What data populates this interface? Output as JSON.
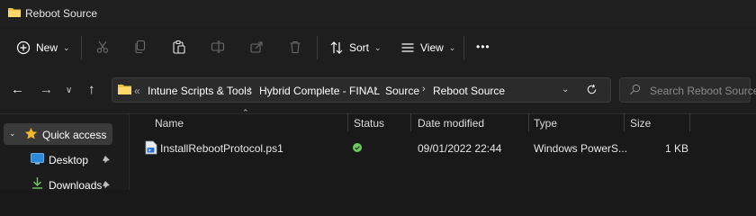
{
  "window": {
    "title": "Reboot Source"
  },
  "toolbar": {
    "new_label": "New",
    "sort_label": "Sort",
    "view_label": "View",
    "more_label": "•••"
  },
  "nav": {
    "back": "←",
    "forward": "→",
    "down": "∨",
    "up": "↑"
  },
  "address": {
    "overflow": "«",
    "crumbs": [
      "Intune Scripts & Tools",
      "Hybrid Complete - FINAL",
      "Source",
      "Reboot Source"
    ],
    "separator": "›"
  },
  "search": {
    "placeholder": "Search Reboot Source"
  },
  "sidebar": {
    "items": [
      {
        "label": "Quick access",
        "icon": "star-icon"
      },
      {
        "label": "Desktop",
        "icon": "desktop-icon",
        "pinned": true
      },
      {
        "label": "Downloads",
        "icon": "download-icon",
        "pinned": true
      }
    ]
  },
  "columns": {
    "name": "Name",
    "status": "Status",
    "date": "Date modified",
    "type": "Type",
    "size": "Size"
  },
  "files": [
    {
      "name": "InstallRebootProtocol.ps1",
      "status": "synced",
      "date": "09/01/2022 22:44",
      "type": "Windows PowerS...",
      "size": "1 KB"
    }
  ],
  "colors": {
    "folder": "#f0c243",
    "status_ok": "#6ccb5f",
    "accent": "#4cc2ff"
  }
}
